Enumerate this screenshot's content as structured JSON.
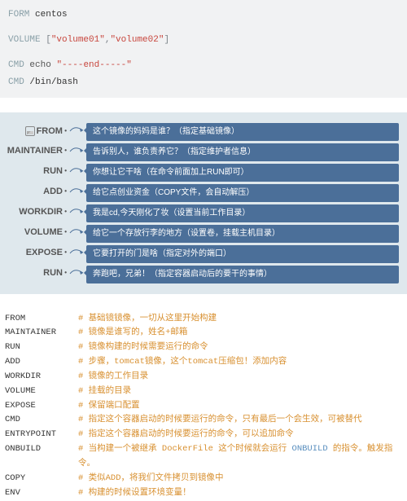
{
  "code": {
    "l1_kw": "FORM",
    "l1_arg": "centos",
    "l2_kw": "VOLUME",
    "l2_b1": "[",
    "l2_s1": "\"volume01\"",
    "l2_c": ",",
    "l2_s2": "\"volume02\"",
    "l2_b2": "]",
    "l3_kw": "CMD",
    "l3_cmd": "echo",
    "l3_str": "\"----end-----\"",
    "l4_kw": "CMD",
    "l4_arg": "/bin/bash"
  },
  "diagram": [
    {
      "label": "FROM",
      "icon": true,
      "text": "这个镜像的妈妈是谁？（指定基础镜像）"
    },
    {
      "label": "MAINTAINER",
      "icon": false,
      "text": "告诉别人，谁负责养它？（指定维护者信息）"
    },
    {
      "label": "RUN",
      "icon": false,
      "text": "你想让它干啥（在命令前面加上RUN即可）"
    },
    {
      "label": "ADD",
      "icon": false,
      "text": "给它点创业资金（COPY文件，会自动解压）"
    },
    {
      "label": "WORKDIR",
      "icon": false,
      "text": "我是cd,今天刚化了妆（设置当前工作目录）"
    },
    {
      "label": "VOLUME",
      "icon": false,
      "text": "给它一个存放行李的地方（设置卷，挂载主机目录）"
    },
    {
      "label": "EXPOSE",
      "icon": false,
      "text": "它要打开的门是啥（指定对外的端口）"
    },
    {
      "label": "RUN",
      "icon": false,
      "text": "奔跑吧，兄弟！（指定容器启动后的要干的事情）"
    }
  ],
  "comments": [
    {
      "k": "FROM",
      "t": "# 基础镜镜像，一切从这里开始构建"
    },
    {
      "k": "MAINTAINER",
      "t": "# 镜像是谁写的，姓名+邮箱"
    },
    {
      "k": "RUN",
      "t": "# 镜像构建的时候需要运行的命令"
    },
    {
      "k": "ADD",
      "t": "# 步骤，tomcat镜像，这个tomcat压缩包！添加内容"
    },
    {
      "k": "WORKDIR",
      "t": "# 镜像的工作目录"
    },
    {
      "k": "VOLUME",
      "t": "# 挂载的目录"
    },
    {
      "k": "EXPOSE",
      "t": "# 保留端口配置"
    },
    {
      "k": "CMD",
      "t": "# 指定这个容器启动的时候要运行的命令，只有最后一个会生效，可被替代"
    },
    {
      "k": "ENTRYPOINT",
      "t": "# 指定这个容器启动的时候要运行的命令，可以追加命令"
    },
    {
      "k": "ONBUILD",
      "pre": "# 当构建一个被继承 DockerFile 这个时候就会运行 ",
      "kw": "ONBUILD",
      "post": "  的指令。触发指令。"
    },
    {
      "k": "COPY",
      "t": "# 类似ADD，将我们文件拷贝到镜像中"
    },
    {
      "k": "ENV",
      "t": "# 构建的时候设置环境变量！"
    }
  ]
}
